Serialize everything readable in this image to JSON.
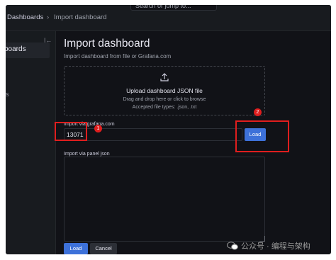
{
  "topbar": {
    "search_hint": "Search or jump to...",
    "breadcrumb": [
      "Dashboards",
      "Import dashboard"
    ],
    "separator": "›"
  },
  "sidebar": {
    "dock_icon": "dock-icon",
    "active_item": "boards",
    "fragment": "s"
  },
  "main": {
    "title": "Import dashboard",
    "subtitle": "Import dashboard from file or Grafana.com",
    "upload": {
      "icon": "upload-icon",
      "title": "Upload dashboard JSON file",
      "hint": "Drag and drop here or click to browse",
      "types": "Accepted file types: .json, .txt"
    },
    "grafana_com": {
      "label": "Import via grafana.com",
      "value": "13071",
      "load_label": "Load"
    },
    "panel_json": {
      "label": "Import via panel json",
      "value": ""
    },
    "buttons": {
      "load": "Load",
      "cancel": "Cancel"
    }
  },
  "annotations": {
    "badge_1": "1",
    "badge_2": "2",
    "color": "#e01e1e"
  },
  "watermark": {
    "text": "公众号 · 编程与架构"
  },
  "colors": {
    "accent": "#3d71d9",
    "background": "#111217",
    "panel": "#181b1f"
  }
}
